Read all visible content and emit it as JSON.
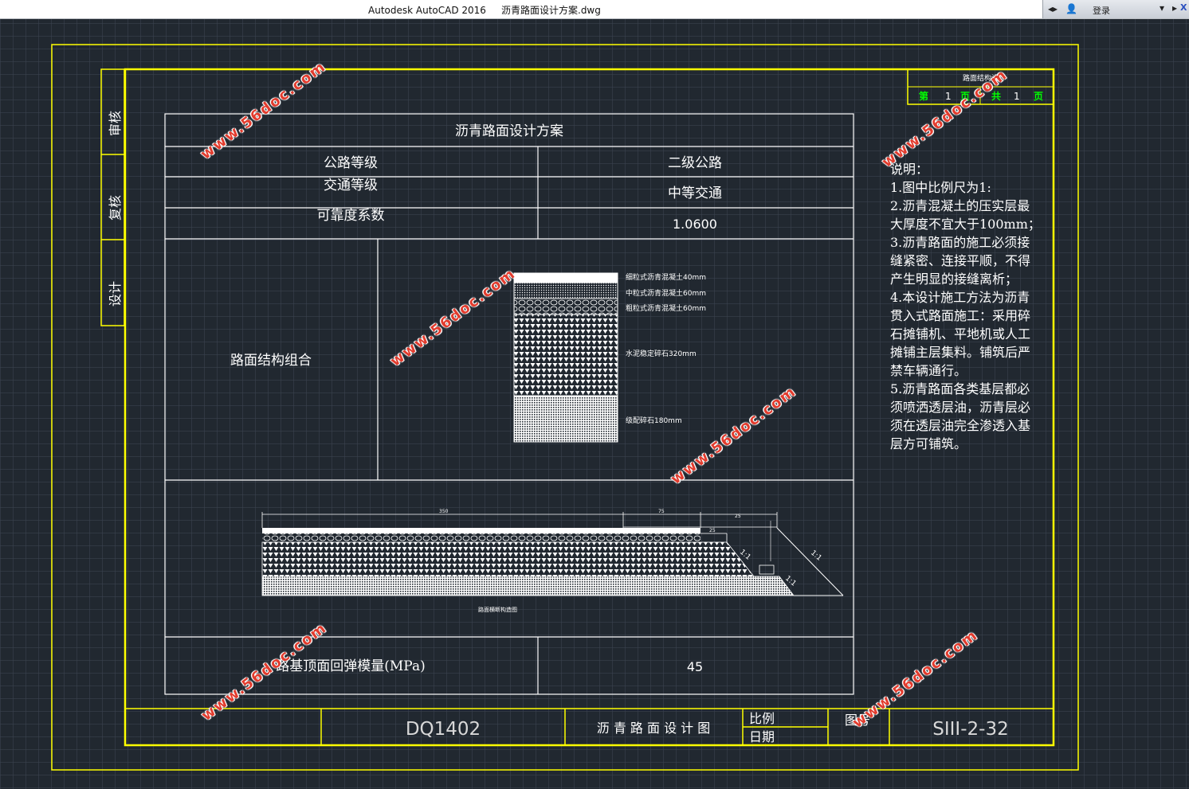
{
  "window": {
    "app_title": "Autodesk AutoCAD 2016",
    "file_name": "沥青路面设计方案.dwg",
    "login_label": "登录",
    "close_symbol": "X"
  },
  "colors": {
    "frame": "#ffff00",
    "lines": "#ffffff",
    "canvas": "#212830",
    "watermark": "#e23c2e",
    "page_counter": "#00ff00"
  },
  "drawing": {
    "table_title": "沥青路面设计方案",
    "rows": [
      {
        "label": "公路等级",
        "value": "二级公路"
      },
      {
        "label": "交通等级",
        "value": "中等交通"
      },
      {
        "label": "可靠度系数",
        "value": "1.0600"
      }
    ],
    "structure_label": "路面结构组合",
    "layers": [
      "细粒式沥青混凝土40mm",
      "中粒式沥青混凝土60mm",
      "粗粒式沥青混凝土60mm",
      "水泥稳定碎石320mm",
      "级配碎石180mm"
    ],
    "section_caption": "路面横断构造图",
    "section_dims": [
      "350",
      "75",
      "25",
      "25"
    ],
    "slope_labels": [
      "1:1",
      "1:1",
      "1:1"
    ],
    "modulus_label": "路基顶面回弹模量(MPa)",
    "modulus_value": "45"
  },
  "left_strip": [
    "审核",
    "复核",
    "设计"
  ],
  "page_counter": {
    "header": "路面结构设计",
    "page_prefix": "第",
    "page_num": "1",
    "page_suffix": "页",
    "total_prefix": "共",
    "total_num": "1",
    "total_suffix": "页"
  },
  "notes": [
    "说明：",
    "1.图中比例尺为1:",
    "2.沥青混凝土的压实层最",
    "大厚度不宜大于100mm；",
    "3.沥青路面的施工必须接",
    "缝紧密、连接平顺，不得",
    "产生明显的接缝离析；",
    "4.本设计施工方法为沥青",
    "贯入式路面施工：采用碎",
    "石摊铺机、平地机或人工",
    "摊铺主层集料。铺筑后严",
    "禁车辆通行。",
    "5.沥青路面各类基层都必",
    "须喷洒透层油，沥青层必",
    "须在透层油完全渗透入基",
    "层方可铺筑。"
  ],
  "title_block": {
    "code": "DQ1402",
    "drawing_name": "沥 青 路 面 设 计 图",
    "scale_label": "比例",
    "date_label": "日期",
    "fig_no_label": "图号",
    "fig_no": "SIII-2-32"
  },
  "watermark_text": "www.56doc.com"
}
